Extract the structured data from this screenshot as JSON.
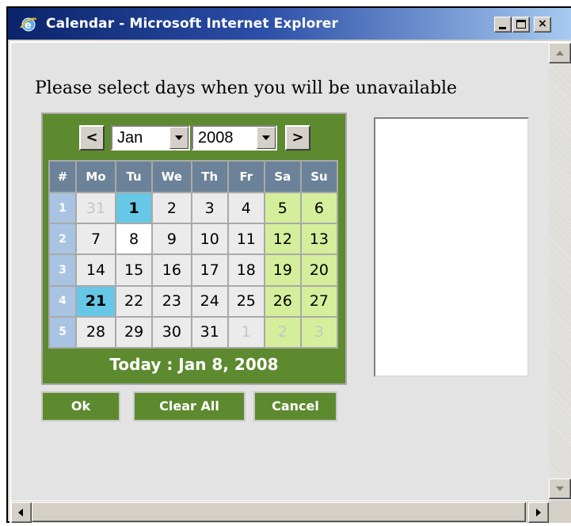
{
  "window": {
    "title": "Calendar - Microsoft Internet Explorer",
    "controls": {
      "minimize": "minimize-icon",
      "maximize": "maximize-icon",
      "close": "×"
    }
  },
  "prompt": "Please select days when you will be unavailable",
  "calendar": {
    "prev_label": "<",
    "next_label": ">",
    "month": "Jan",
    "year": "2008",
    "week_header": "#",
    "days": [
      "Mo",
      "Tu",
      "We",
      "Th",
      "Fr",
      "Sa",
      "Su"
    ],
    "weeks": [
      {
        "num": "1",
        "days": [
          "31",
          "1",
          "2",
          "3",
          "4",
          "5",
          "6"
        ]
      },
      {
        "num": "2",
        "days": [
          "7",
          "8",
          "9",
          "10",
          "11",
          "12",
          "13"
        ]
      },
      {
        "num": "3",
        "days": [
          "14",
          "15",
          "16",
          "17",
          "18",
          "19",
          "20"
        ]
      },
      {
        "num": "4",
        "days": [
          "21",
          "22",
          "23",
          "24",
          "25",
          "26",
          "27"
        ]
      },
      {
        "num": "5",
        "days": [
          "28",
          "29",
          "30",
          "31",
          "1",
          "2",
          "3"
        ]
      }
    ],
    "today_label": "Today : Jan 8, 2008"
  },
  "buttons": {
    "ok": "Ok",
    "clear_all": "Clear All",
    "cancel": "Cancel"
  },
  "colors": {
    "calendar_green": "#5d8a2f",
    "header_slate": "#6b8299",
    "weekend": "#d5ee9b",
    "selected_day": "#66c8e6",
    "week_number": "#a9c4e3"
  }
}
